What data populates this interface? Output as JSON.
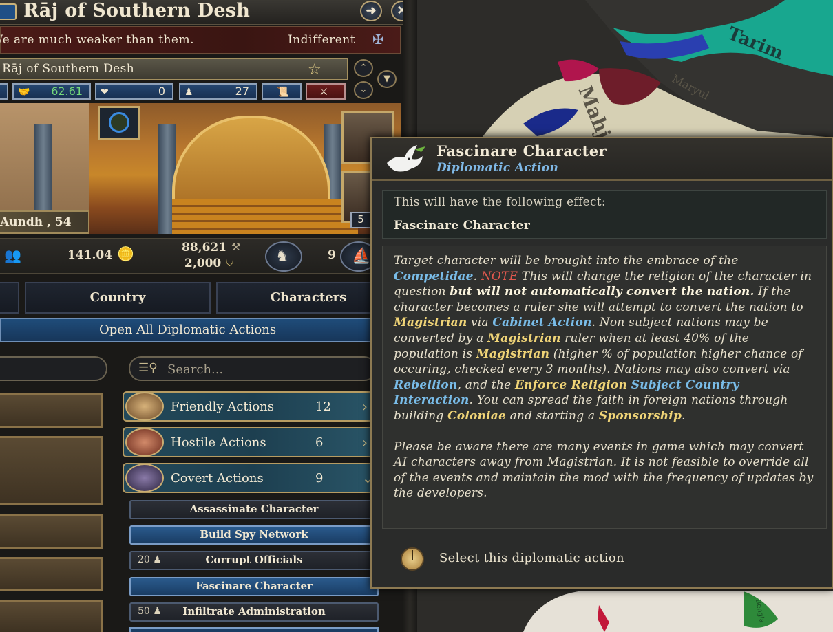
{
  "window": {
    "title": "Rāj of Southern Desh",
    "relation_text": "We are much weaker than them.",
    "attitude": "Indifferent"
  },
  "country": {
    "name": "Rāj of Southern Desh",
    "stats": [
      "62.61",
      "0",
      "27"
    ]
  },
  "ruler": {
    "label": "Aundh , 54"
  },
  "portrait_badge": "5",
  "resources": {
    "gold": "141.04",
    "manpower": "88,621",
    "sailors": "2,000",
    "army": "9"
  },
  "tabs": [
    "Country",
    "Characters"
  ],
  "open_all_label": "Open All Diplomatic Actions",
  "search": {
    "placeholder": "Search..."
  },
  "categories": [
    {
      "label": "Friendly Actions",
      "count": "12"
    },
    {
      "label": "Hostile Actions",
      "count": "6"
    },
    {
      "label": "Covert Actions",
      "count": "9"
    }
  ],
  "actions": [
    {
      "label": "Assassinate Character",
      "cost": ""
    },
    {
      "label": "Build Spy Network",
      "cost": ""
    },
    {
      "label": "Corrupt Officials",
      "cost": "20"
    },
    {
      "label": "Fascinare Character",
      "cost": ""
    },
    {
      "label": "Infiltrate Administration",
      "cost": "50"
    }
  ],
  "map_labels": [
    "Tarim",
    "Mahj",
    "Maryul",
    "Bengla"
  ],
  "tooltip": {
    "title": "Fascinare Character",
    "subtitle": "Diplomatic Action",
    "effect_intro": "This will have the following effect:",
    "effect_name": "Fascinare Character",
    "desc": {
      "s1": "Target character will be brought into the embrace of the ",
      "competitae": "Competidae",
      "s2": ". ",
      "note": "NOTE",
      "s3": " This will change the religion of the character in question ",
      "bold1": "but will not automatically convert the nation.",
      "s4": " If the character becomes a ruler she will attempt to convert the nation to ",
      "magistrian1": "Magistrian",
      "s5": " via ",
      "cabinet": "Cabinet Action",
      "s6": ". Non subject nations may be converted by a ",
      "magistrian2": "Magistrian",
      "s7": " ruler when at least 40% of the population is ",
      "magistrian3": "Magistrian",
      "s8": " (higher % of population higher chance of occuring, checked every 3 months). Nations may also convert via ",
      "rebellion": "Rebellion",
      "s9": ", and the ",
      "enforce": "Enforce Religion",
      "s10": " ",
      "subject": "Subject Country Interaction",
      "s11": ". You can spread the faith in foreign nations through building ",
      "coloniae": "Coloniae",
      "s12": " and starting a ",
      "sponsorship": "Sponsorship",
      "s13": ".",
      "p2": "Please be aware there are many events in game which may convert AI characters away from Magistrian. It is not feasible to override all of the events and maintain the mod with the frequency of updates by the developers."
    },
    "select_label": "Select this diplomatic action"
  },
  "colors": {
    "accent_gold": "#f0d477",
    "accent_blue": "#79bce8",
    "note_red": "#e0584e",
    "button_blue": "#1f4c7a"
  }
}
